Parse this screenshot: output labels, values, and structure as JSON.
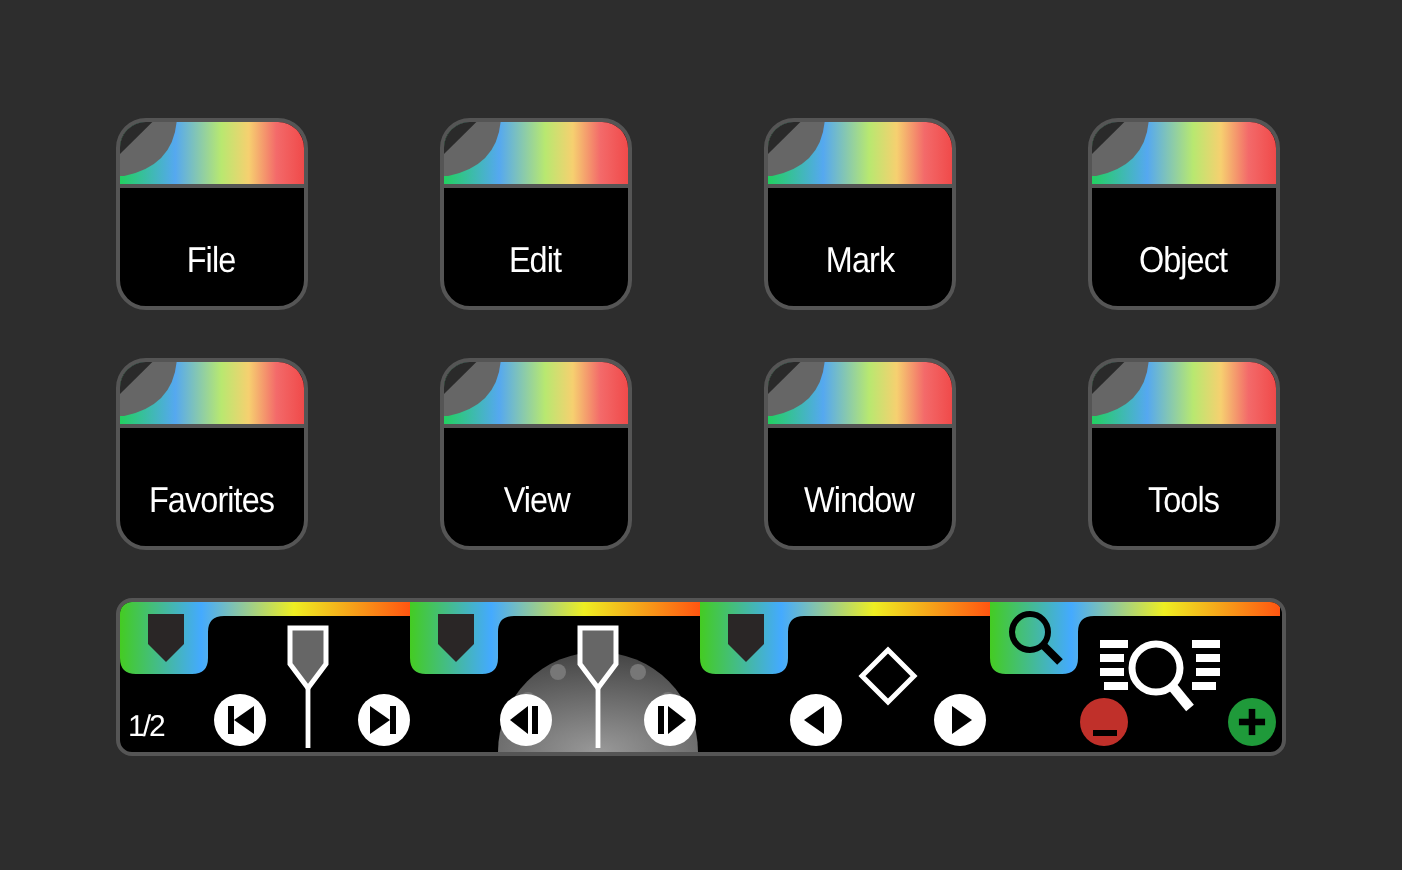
{
  "menu_tiles": [
    {
      "label": "File"
    },
    {
      "label": "Edit"
    },
    {
      "label": "Mark"
    },
    {
      "label": "Object"
    },
    {
      "label": "Favorites"
    },
    {
      "label": "View"
    },
    {
      "label": "Window"
    },
    {
      "label": "Tools"
    }
  ],
  "toolbar": {
    "page_indicator": "1/2",
    "sections": [
      {
        "kind": "page-nav"
      },
      {
        "kind": "jog"
      },
      {
        "kind": "mark-nav"
      },
      {
        "kind": "zoom"
      }
    ]
  }
}
